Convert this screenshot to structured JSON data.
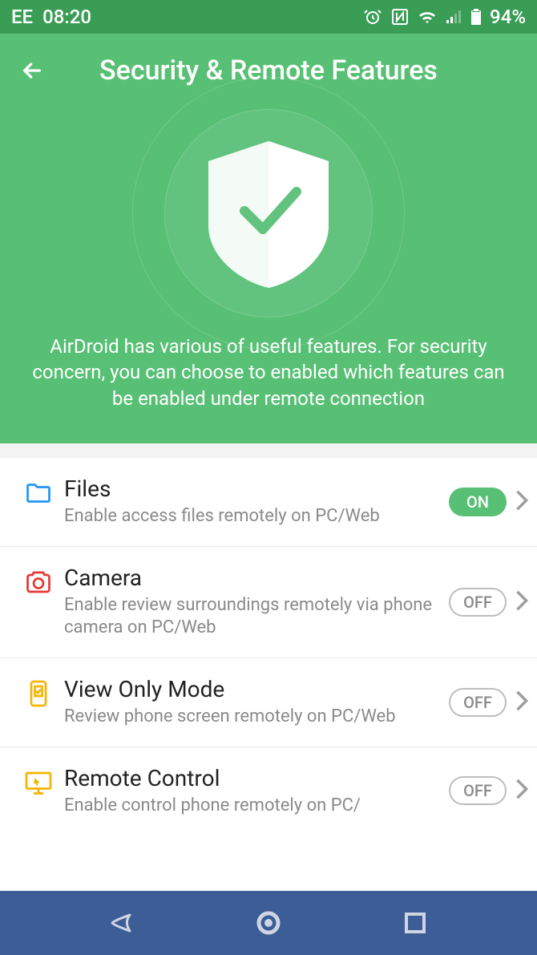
{
  "status": {
    "carrier": "EE",
    "time": "08:20",
    "battery": "94%"
  },
  "header": {
    "title": "Security & Remote Features",
    "description": "AirDroid has various of useful features. For security concern, you can choose to enabled which features can be enabled under remote connection"
  },
  "items": [
    {
      "title": "Files",
      "desc": "Enable access files remotely on PC/Web",
      "toggle": "ON",
      "on": true,
      "iconColor": "#2196f3"
    },
    {
      "title": "Camera",
      "desc": "Enable review surroundings remotely via phone camera on PC/Web",
      "toggle": "OFF",
      "on": false,
      "iconColor": "#e53935"
    },
    {
      "title": "View Only Mode",
      "desc": "Review phone screen remotely on PC/Web",
      "toggle": "OFF",
      "on": false,
      "iconColor": "#f5b400"
    },
    {
      "title": "Remote Control",
      "desc": "Enable control phone remotely on PC/",
      "toggle": "OFF",
      "on": false,
      "iconColor": "#f5b400"
    }
  ]
}
